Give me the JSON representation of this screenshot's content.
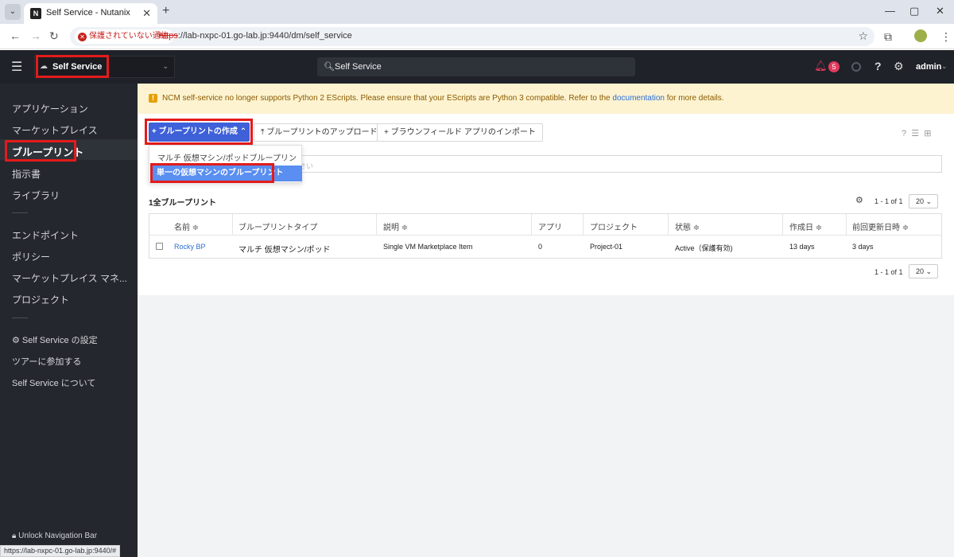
{
  "browser": {
    "tab_title": "Self Service - Nutanix",
    "favicon_text": "N",
    "security_label": "保護されていない通信",
    "url_scheme": "https",
    "url_rest": "://lab-nxpc-01.go-lab.jp:9440/dm/self_service",
    "status_url": "https://lab-nxpc-01.go-lab.jp:9440/#"
  },
  "header": {
    "app_name": "Self Service",
    "search_text": "Self Service",
    "alert_count": "5",
    "user": "admin"
  },
  "sidebar": {
    "items": [
      {
        "label": "アプリケーション"
      },
      {
        "label": "マーケットプレイス"
      },
      {
        "label": "ブループリント"
      },
      {
        "label": "指示書"
      },
      {
        "label": "ライブラリ"
      },
      {
        "label": "エンドポイント"
      },
      {
        "label": "ポリシー"
      },
      {
        "label": "マーケットプレイス マネ..."
      },
      {
        "label": "プロジェクト"
      },
      {
        "label": "Self Service の設定"
      },
      {
        "label": "ツアーに参加する"
      },
      {
        "label": "Self Service について"
      }
    ],
    "unlock_label": "Unlock Navigation Bar"
  },
  "warning": {
    "text": "NCM self-service no longer supports Python 2 EScripts. Please ensure that your EScripts are Python 3 compatible. Refer to the",
    "link": "documentation",
    "suffix": "for more details."
  },
  "toolbar": {
    "create_label": "+ ブループリントの作成 ⌃",
    "upload_label": "ブループリントのアップロード",
    "import_label": "ブラウンフィールド アプリのインポート"
  },
  "dropdown": {
    "items": [
      {
        "label": "マルチ 仮想マシン/ポッドブループリント"
      },
      {
        "label": "単一の仮想マシンのブループリント"
      }
    ]
  },
  "search": {
    "placeholder": "さい"
  },
  "list": {
    "count_label": "1全ブループリント",
    "pager_range": "1 - 1 of 1",
    "page_size": "20"
  },
  "table": {
    "headers": [
      "名前 ≑",
      "ブループリントタイプ",
      "説明 ≑",
      "アプリ",
      "プロジェクト",
      "状態 ≑",
      "作成日 ≑",
      "前回更新日時 ≑"
    ],
    "rows": [
      {
        "name": "Rocky BP",
        "type": "マルチ 仮想マシン/ポッド",
        "description": "Single VM Marketplace Item",
        "apps": "0",
        "project": "Project-01",
        "state": "Active（保護有効)",
        "created": "13 days",
        "updated": "3 days"
      }
    ]
  },
  "colors": {
    "header_bg": "#1f2228",
    "sidebar_bg": "#24272d",
    "primary": "#3e60d8",
    "highlight": "#e31b1b",
    "warning_bg": "#fdf3d0"
  }
}
